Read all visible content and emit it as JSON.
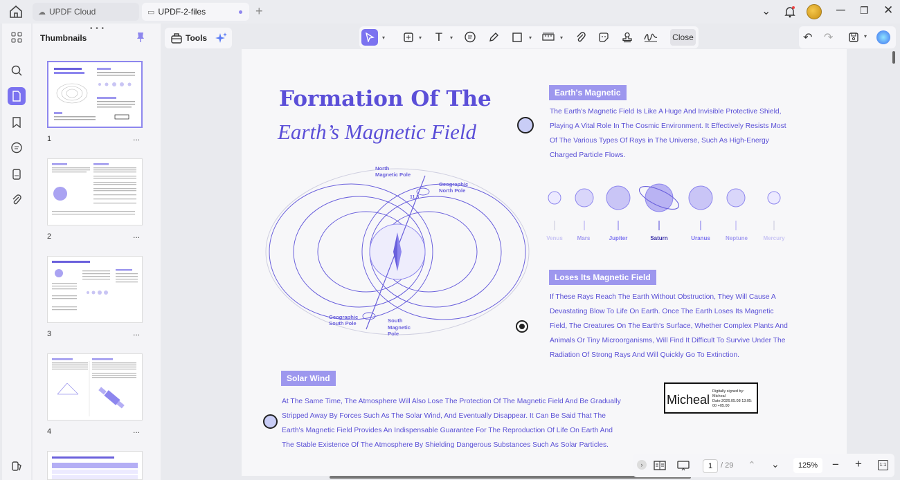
{
  "tabs": [
    {
      "label": "UPDF Cloud"
    },
    {
      "label": "UPDF-2-files"
    }
  ],
  "sidebar": {
    "title": "Thumbnails",
    "thumbnails": [
      {
        "number": "1"
      },
      {
        "number": "2"
      },
      {
        "number": "3"
      },
      {
        "number": "4"
      }
    ],
    "more_label": "..."
  },
  "toolbar": {
    "tools_label": "Tools",
    "close_label": "Close"
  },
  "page": {
    "title_line1": "Formation Of The",
    "title_line2": "Earth’s Magnetic Field",
    "section1_heading": "Earth's Magnetic",
    "section1_lines": [
      "The Earth's Magnetic Field Is Like A Huge And Invisible Protective Shield,",
      "Playing A Vital Role In The Cosmic Environment. It Effectively Resists Most",
      "Of The Various Types Of Rays in The Universe, Such As High-Energy",
      "Charged Particle Flows."
    ],
    "planets": [
      "Venus",
      "Mars",
      "Jupiter",
      "Saturn",
      "Uranus",
      "Neptune",
      "Mercury"
    ],
    "section2_heading": "Loses Its Magnetic Field",
    "section2_lines": [
      "If These Rays Reach The Earth Without Obstruction, They Will Cause A",
      "Devastating Blow To Life On Earth. Once The Earth Loses Its Magnetic",
      "Field, The Creatures On The Earth's Surface, Whether Complex Plants And",
      "Animals Or Tiny Microorganisms, Will Find It Difficult To Survive Under The",
      "Radiation Of Strong Rays And Will Quickly Go To Extinction."
    ],
    "section3_heading": "Solar Wind",
    "section3_lines": [
      "At The Same Time, The Atmosphere Will Also Lose The Protection Of The Magnetic Field And Be Gradually",
      "Stripped Away By Forces Such As The Solar Wind, And Eventually Disappear. It Can Be Said That The",
      "Earth's Magnetic Field Provides An Indispensable Guarantee For The Reproduction Of Life On Earth And",
      "The Stable Existence Of The Atmosphere By Shielding Dangerous Substances Such As Solar Particles."
    ],
    "diagram": {
      "north_magnetic_pole": [
        "North",
        "Magnetic Pole"
      ],
      "geographic_north_pole": [
        "Geographic",
        "North Pole"
      ],
      "geographic_south_pole": [
        "Geographic",
        "South Pole"
      ],
      "south_magnetic_pole": [
        "South",
        "Magnetic",
        "Pole"
      ],
      "angle": "11.5"
    },
    "signature": {
      "name": "Micheal",
      "details": [
        "Digitally signed by:",
        "Micheal",
        "Date:2026.05.08 13:05:",
        "00 +05.00"
      ]
    }
  },
  "navigation": {
    "current_page": "1",
    "total_pages": "/ 29",
    "zoom": "125%"
  },
  "colors": {
    "accent": "#7b72f0",
    "text_purple": "#5a50d6",
    "chip": "#9d97ee"
  }
}
